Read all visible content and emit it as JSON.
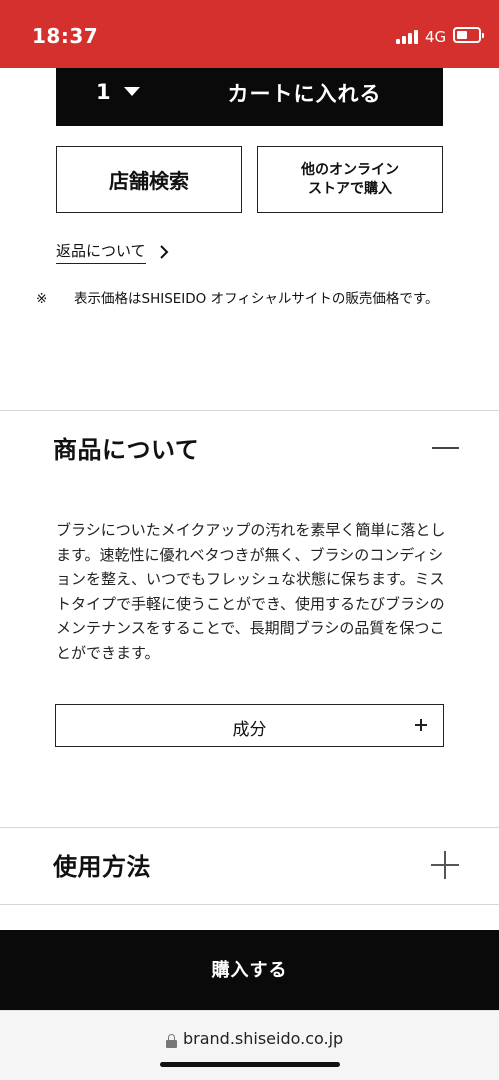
{
  "status_bar": {
    "time": "18:37",
    "network": "4G",
    "signal_icon": "signal-icon",
    "battery_icon": "battery-icon",
    "background": "#d4312e"
  },
  "purchase": {
    "quantity": "1",
    "add_to_cart_label": "カートに入れる",
    "store_search_label": "店舗検索",
    "other_online_stores_label_line1": "他のオンライン",
    "other_online_stores_label_line2": "ストアで購入",
    "returns_link": "返品について",
    "price_note_mark": "※",
    "price_note": "表示価格はSHISEIDO オフィシャルサイトの販売価格です。"
  },
  "product_about": {
    "title": "商品について",
    "expanded": true,
    "description": "ブラシについたメイクアップの汚れを素早く簡単に落とします。速乾性に優れベタつきが無く、ブラシのコンディションを整え、いつでもフレッシュな状態に保ちます。ミストタイプで手軽に使うことができ、使用するたびブラシのメンテナンスをすることで、長期間ブラシの品質を保つことができます。",
    "ingredients_label": "成分"
  },
  "usage": {
    "title": "使用方法",
    "expanded": false
  },
  "buy_bar": {
    "label": "購入する"
  },
  "browser": {
    "url": "brand.shiseido.co.jp"
  },
  "colors": {
    "accent_red": "#d4312e",
    "button_black": "#0a0a0a"
  }
}
